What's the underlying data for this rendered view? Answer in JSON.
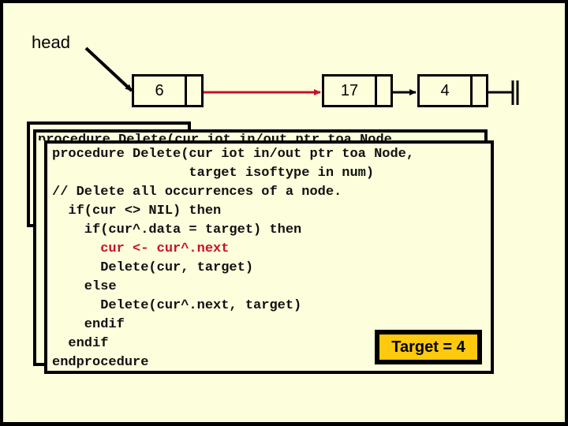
{
  "diagram": {
    "head_label": "head",
    "nodes": [
      {
        "value": "6"
      },
      {
        "value": "17"
      },
      {
        "value": "4"
      }
    ],
    "highlight_color": "#C8102E",
    "end_marker": "nil-terminator"
  },
  "code": {
    "lines": [
      "procedure Delete(cur iot in/out ptr toa Node,",
      "                 target isoftype in num)",
      "// Delete all occurrences of a node.",
      "  if(cur <> NIL) then",
      "    if(cur^.data = target) then",
      "      cur <- cur^.next",
      "      Delete(cur, target)",
      "    else",
      "      Delete(cur^.next, target)",
      "    endif",
      "  endif",
      "endprocedure"
    ],
    "highlighted_line_index": 5
  },
  "target_label": "Target = 4",
  "colors": {
    "background": "#FCFEDC",
    "target_fill": "#FFC90E",
    "highlight": "#C8102E"
  }
}
